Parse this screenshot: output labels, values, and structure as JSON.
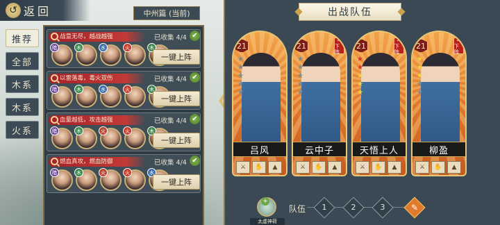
{
  "header": {
    "back_label": "返回",
    "back_icon": "swirl-back-icon"
  },
  "region": {
    "label": "中州篇 (当前)"
  },
  "categories": [
    {
      "label": "推荐",
      "active": true
    },
    {
      "label": "全部",
      "active": false
    },
    {
      "label": "木系",
      "active": false
    },
    {
      "label": "木系",
      "active": false
    },
    {
      "label": "火系",
      "active": false
    }
  ],
  "sets": [
    {
      "title": "战意无尽，越战越强",
      "collected": "已收集 4/4",
      "button": "一键上阵",
      "elements": [
        "dark",
        "wood",
        "water",
        "fire",
        "wood"
      ]
    },
    {
      "title": "以雷落毒，毒火双伤",
      "collected": "已收集 4/4",
      "button": "一键上阵",
      "elements": [
        "dark",
        "wood",
        "water",
        "fire",
        "wood"
      ]
    },
    {
      "title": "血量越低，攻击越强",
      "collected": "已收集 4/4",
      "button": "一键上阵",
      "elements": [
        "dark",
        "wood",
        "fire",
        "fire",
        "wood"
      ]
    },
    {
      "title": "燃血真攻，燃血防御",
      "collected": "已收集 4/4",
      "button": "一键上阵",
      "elements": [
        "dark",
        "wood",
        "fire",
        "fire",
        "water"
      ]
    }
  ],
  "team": {
    "title": "出战队伍",
    "remove_label": "下阵",
    "members": [
      {
        "name": "吕风",
        "level": "21",
        "stars": [
          0,
          0,
          0,
          0,
          0
        ],
        "removable": false
      },
      {
        "name": "云中子",
        "level": "21",
        "stars": [
          0,
          0,
          0,
          0,
          0
        ],
        "removable": true
      },
      {
        "name": "天悟上人",
        "level": "21",
        "stars": [
          2,
          2,
          1,
          1,
          1
        ],
        "removable": true
      },
      {
        "name": "柳盈",
        "level": "21",
        "stars": [
          1,
          1,
          1,
          0,
          0
        ],
        "removable": true
      }
    ]
  },
  "team_bar": {
    "skill_label": "太虚神荷",
    "team_label": "队伍",
    "slots": [
      "1",
      "2",
      "3"
    ],
    "edit_icon": "pencil-icon"
  },
  "colors": {
    "accent": "#c23a35",
    "panel": "#3a4954",
    "gold": "#c9a24b",
    "card_orange": "#e07a2c"
  }
}
